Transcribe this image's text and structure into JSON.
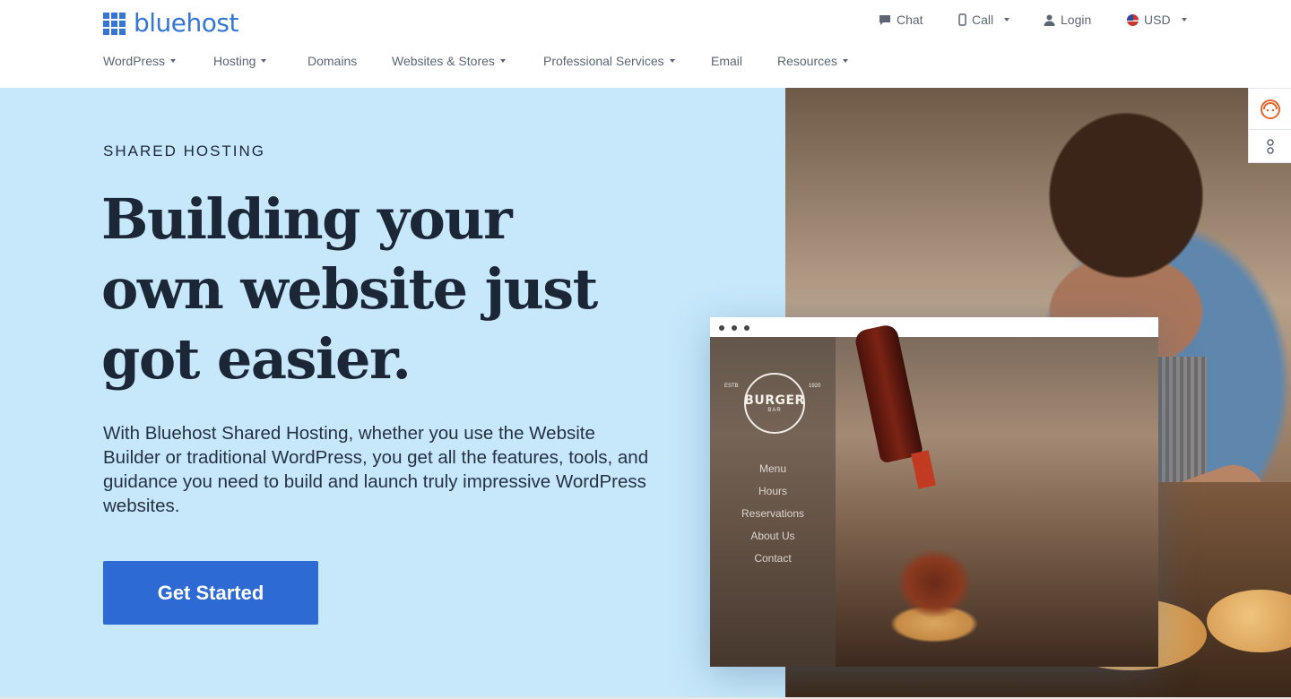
{
  "brand": {
    "name": "bluehost",
    "color": "#3575d3"
  },
  "utility": {
    "chat": "Chat",
    "call": "Call",
    "login": "Login",
    "currency": "USD"
  },
  "nav": {
    "items": [
      {
        "label": "WordPress",
        "dropdown": true
      },
      {
        "label": "Hosting",
        "dropdown": true
      },
      {
        "label": "Domains",
        "dropdown": false
      },
      {
        "label": "Websites & Stores",
        "dropdown": true
      },
      {
        "label": "Professional Services",
        "dropdown": true
      },
      {
        "label": "Email",
        "dropdown": false
      },
      {
        "label": "Resources",
        "dropdown": true
      }
    ]
  },
  "hero": {
    "eyebrow": "SHARED HOSTING",
    "headline_line1": "Building your",
    "headline_line2": "own website just",
    "headline_line3": "got easier.",
    "subcopy": "With Bluehost Shared Hosting, whether you use the Website Builder or traditional WordPress, you get all the features, tools, and guidance you need to build and launch truly impressive WordPress websites.",
    "cta_label": "Get Started",
    "background_color": "#c7e8fb",
    "cta_color": "#2e6ad4"
  },
  "mockup": {
    "badge_title": "BURGER",
    "badge_sub": "BAR",
    "badge_left": "ESTB",
    "badge_right": "1920",
    "menu": [
      "Menu",
      "Hours",
      "Reservations",
      "About Us",
      "Contact"
    ]
  },
  "side_widget": {
    "icons": [
      "support-agent-icon",
      "accessibility-icon"
    ]
  }
}
